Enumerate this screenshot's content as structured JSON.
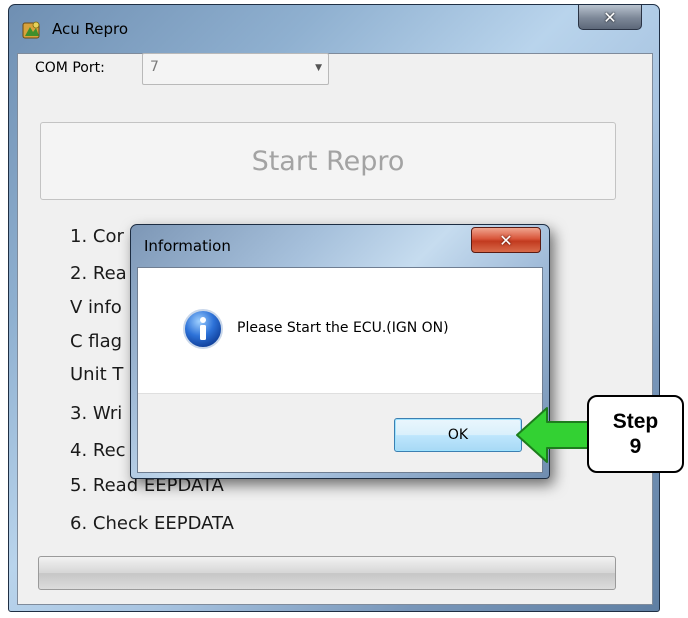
{
  "window": {
    "title": "Acu Repro",
    "close_glyph": "✕"
  },
  "com_port": {
    "label": "COM Port:",
    "value": "7"
  },
  "start_button": {
    "label": "Start Repro"
  },
  "steps": [
    "1. Cor",
    "2. Rea",
    "V info",
    "C flag",
    "Unit T",
    "3. Wri",
    "4. Rec",
    "5. Read EEPDATA",
    "6. Check EEPDATA"
  ],
  "progress": {
    "value": 0
  },
  "dialog": {
    "title": "Information",
    "close_glyph": "✕",
    "message": "Please Start the ECU.(IGN ON)",
    "ok_label": "OK"
  },
  "annotation": {
    "line1": "Step",
    "line2": "9",
    "arrow_color": "#33d133"
  },
  "icons": {
    "app": "app-icon",
    "info": "info-icon",
    "dropdown": "chevron-down-icon"
  }
}
